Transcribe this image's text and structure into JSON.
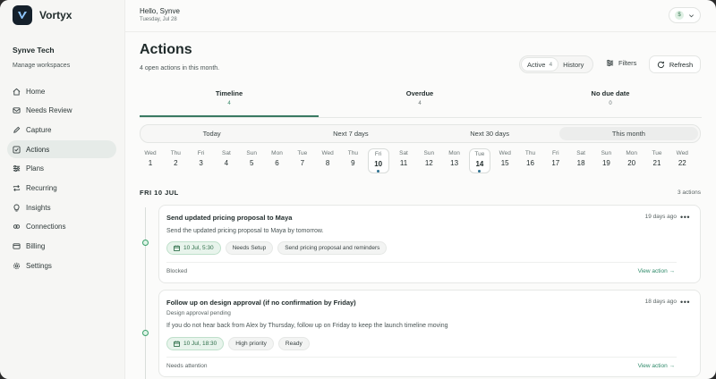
{
  "app": {
    "name": "Vortyx"
  },
  "sidebar": {
    "workspace": "Synve Tech",
    "manage": "Manage workspaces",
    "items": [
      {
        "label": "Home",
        "icon": "home-icon"
      },
      {
        "label": "Needs Review",
        "icon": "mail-icon"
      },
      {
        "label": "Capture",
        "icon": "pen-icon"
      },
      {
        "label": "Actions",
        "icon": "check-square-icon",
        "active": true
      },
      {
        "label": "Plans",
        "icon": "sliders-icon"
      },
      {
        "label": "Recurring",
        "icon": "repeat-icon"
      },
      {
        "label": "Insights",
        "icon": "bulb-icon"
      },
      {
        "label": "Connections",
        "icon": "plug-icon"
      },
      {
        "label": "Billing",
        "icon": "card-icon"
      },
      {
        "label": "Settings",
        "icon": "gear-icon"
      }
    ]
  },
  "header": {
    "greeting": "Hello, Synve",
    "date": "Tuesday, Jul 28",
    "currency": "$"
  },
  "page": {
    "title": "Actions",
    "subtitle": "4 open actions in this month.",
    "segment": {
      "active_label": "Active",
      "active_count": "4",
      "history_label": "History"
    },
    "filters_label": "Filters",
    "refresh_label": "Refresh"
  },
  "tabs": [
    {
      "label": "Timeline",
      "count": "4"
    },
    {
      "label": "Overdue",
      "count": "4"
    },
    {
      "label": "No due date",
      "count": "0"
    }
  ],
  "ranges": [
    "Today",
    "Next 7 days",
    "Next 30 days",
    "This month"
  ],
  "days": [
    {
      "n": "Wed",
      "d": "1"
    },
    {
      "n": "Thu",
      "d": "2"
    },
    {
      "n": "Fri",
      "d": "3"
    },
    {
      "n": "Sat",
      "d": "4"
    },
    {
      "n": "Sun",
      "d": "5"
    },
    {
      "n": "Mon",
      "d": "6"
    },
    {
      "n": "Tue",
      "d": "7"
    },
    {
      "n": "Wed",
      "d": "8"
    },
    {
      "n": "Thu",
      "d": "9"
    },
    {
      "n": "Fri",
      "d": "10"
    },
    {
      "n": "Sat",
      "d": "11"
    },
    {
      "n": "Sun",
      "d": "12"
    },
    {
      "n": "Mon",
      "d": "13"
    },
    {
      "n": "Tue",
      "d": "14"
    },
    {
      "n": "Wed",
      "d": "15"
    },
    {
      "n": "Thu",
      "d": "16"
    },
    {
      "n": "Fri",
      "d": "17"
    },
    {
      "n": "Sat",
      "d": "18"
    },
    {
      "n": "Sun",
      "d": "19"
    },
    {
      "n": "Mon",
      "d": "20"
    },
    {
      "n": "Tue",
      "d": "21"
    },
    {
      "n": "Wed",
      "d": "22"
    }
  ],
  "group": {
    "label": "FRI 10 JUL",
    "count": "3 actions"
  },
  "cards": [
    {
      "title": "Send updated pricing proposal to Maya",
      "age": "19 days ago",
      "subtitle": "",
      "desc": "Send the updated pricing proposal to Maya by tomorrow.",
      "due": "10 Jul, 5:30",
      "chips": [
        "Needs Setup",
        "Send pricing proposal and reminders"
      ],
      "status": "Blocked",
      "link": "View action →"
    },
    {
      "title": "Follow up on design approval (if no confirmation by Friday)",
      "age": "18 days ago",
      "subtitle": "Design approval pending",
      "desc": "If you do not hear back from Alex by Thursday, follow up on Friday to keep the launch timeline moving",
      "due": "10 Jul, 18:30",
      "chips": [
        "High priority",
        "Ready"
      ],
      "status": "Needs attention",
      "link": "View action →"
    }
  ]
}
